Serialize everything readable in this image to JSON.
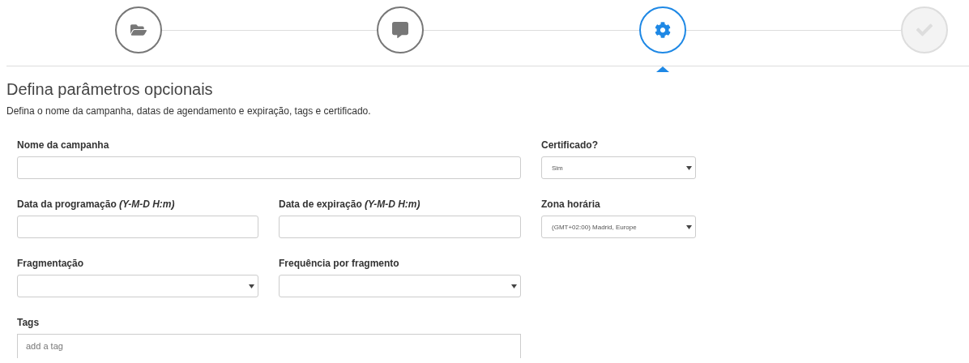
{
  "steps": [
    {
      "selected": false,
      "done": true
    },
    {
      "selected": false,
      "done": true
    },
    {
      "selected": true,
      "done": false
    },
    {
      "selected": false,
      "done": false
    }
  ],
  "heading": "Defina parâmetros opcionais",
  "description": "Defina o nome da campanha, datas de agendamento e expiração, tags e certificado.",
  "form": {
    "main": [
      {
        "label": "Nome da campanha",
        "kind": "text",
        "wide": true
      },
      {
        "label": "Data da programação *(Y-M-D H:m)*",
        "kind": "text",
        "wide": false
      },
      {
        "label": "Data de expiração *(Y-M-D H:m)*",
        "kind": "text",
        "wide": false
      },
      {
        "label": "Fragmentação",
        "kind": "select",
        "wide": false
      },
      {
        "label": "Frequência por fragmento",
        "kind": "select",
        "wide": false
      },
      {
        "label": "Tags",
        "kind": "tags",
        "wide": true,
        "placeholder": "add a tag"
      }
    ],
    "side": [
      {
        "label": "Certificado?",
        "kind": "select",
        "value": "Sim"
      },
      {
        "label": "Zona horária",
        "kind": "select",
        "value": "(GMT+02:00) Madrid, Europe"
      }
    ]
  }
}
